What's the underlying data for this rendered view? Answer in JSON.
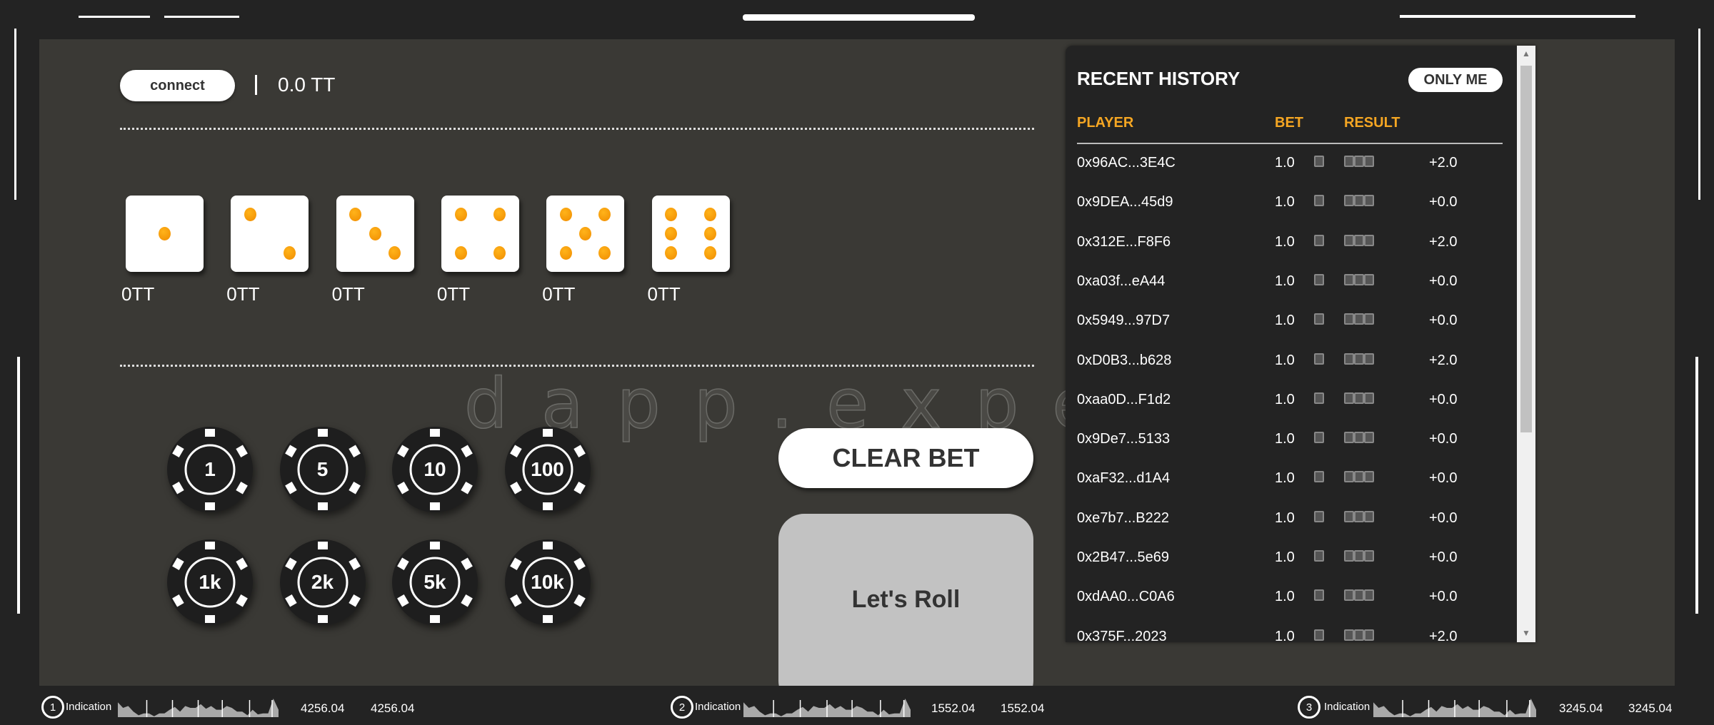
{
  "header": {
    "connect_label": "connect",
    "separator": "|",
    "balance": "0.0 TT"
  },
  "dice": [
    {
      "face": 1,
      "bet": "0TT"
    },
    {
      "face": 2,
      "bet": "0TT"
    },
    {
      "face": 3,
      "bet": "0TT"
    },
    {
      "face": 4,
      "bet": "0TT"
    },
    {
      "face": 5,
      "bet": "0TT"
    },
    {
      "face": 6,
      "bet": "0TT"
    }
  ],
  "watermark": "dapp.expert",
  "chips": [
    "1",
    "5",
    "10",
    "100",
    "1k",
    "2k",
    "5k",
    "10k"
  ],
  "actions": {
    "clear_bet": "CLEAR BET",
    "roll": "Let's Roll"
  },
  "history": {
    "title": "RECENT HISTORY",
    "only_me": "ONLY ME",
    "columns": [
      "PLAYER",
      "BET",
      "RESULT"
    ],
    "rows": [
      {
        "player": "0x96AC...3E4C",
        "bet": "1.0",
        "payout": "+2.0"
      },
      {
        "player": "0x9DEA...45d9",
        "bet": "1.0",
        "payout": "+0.0"
      },
      {
        "player": "0x312E...F8F6",
        "bet": "1.0",
        "payout": "+2.0"
      },
      {
        "player": "0xa03f...eA44",
        "bet": "1.0",
        "payout": "+0.0"
      },
      {
        "player": "0x5949...97D7",
        "bet": "1.0",
        "payout": "+0.0"
      },
      {
        "player": "0xD0B3...b628",
        "bet": "1.0",
        "payout": "+2.0"
      },
      {
        "player": "0xaa0D...F1d2",
        "bet": "1.0",
        "payout": "+0.0"
      },
      {
        "player": "0x9De7...5133",
        "bet": "1.0",
        "payout": "+0.0"
      },
      {
        "player": "0xaF32...d1A4",
        "bet": "1.0",
        "payout": "+0.0"
      },
      {
        "player": "0xe7b7...B222",
        "bet": "1.0",
        "payout": "+0.0"
      },
      {
        "player": "0x2B47...5e69",
        "bet": "1.0",
        "payout": "+0.0"
      },
      {
        "player": "0xdAA0...C0A6",
        "bet": "1.0",
        "payout": "+0.0"
      },
      {
        "player": "0x375F...2023",
        "bet": "1.0",
        "payout": "+2.0"
      }
    ]
  },
  "indicators": [
    {
      "num": "1",
      "label": "Indication",
      "value_a": "4256.04",
      "value_b": "4256.04"
    },
    {
      "num": "2",
      "label": "Indication",
      "value_a": "1552.04",
      "value_b": "1552.04"
    },
    {
      "num": "3",
      "label": "Indication",
      "value_a": "3245.04",
      "value_b": "3245.04"
    }
  ],
  "colors": {
    "accent": "#f5a623",
    "panel": "#3a3935",
    "background": "#232323",
    "pip": "#f59b0a"
  }
}
